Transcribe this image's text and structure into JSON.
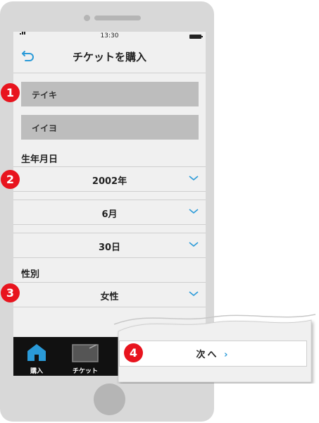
{
  "status": {
    "time": "13:30"
  },
  "header": {
    "title": "チケットを購入",
    "back_icon": "back-arrow-icon"
  },
  "form": {
    "name_last_value": "テイキ",
    "name_first_value": "イイヨ",
    "birth_label": "生年月日",
    "birth_year": "2002年",
    "birth_month": "6月",
    "birth_day": "30日",
    "gender_label": "性別",
    "gender_value": "女性"
  },
  "tabs": [
    {
      "label": "購入",
      "icon": "home-icon"
    },
    {
      "label": "チケット",
      "icon": "ticket-icon"
    }
  ],
  "callout": {
    "next_label": "次へ",
    "next_arrow": "›"
  },
  "badges": [
    "1",
    "2",
    "3",
    "4"
  ],
  "colors": {
    "accent": "#2a9ad8",
    "badge": "#e8141e",
    "tabbar": "#111111"
  }
}
